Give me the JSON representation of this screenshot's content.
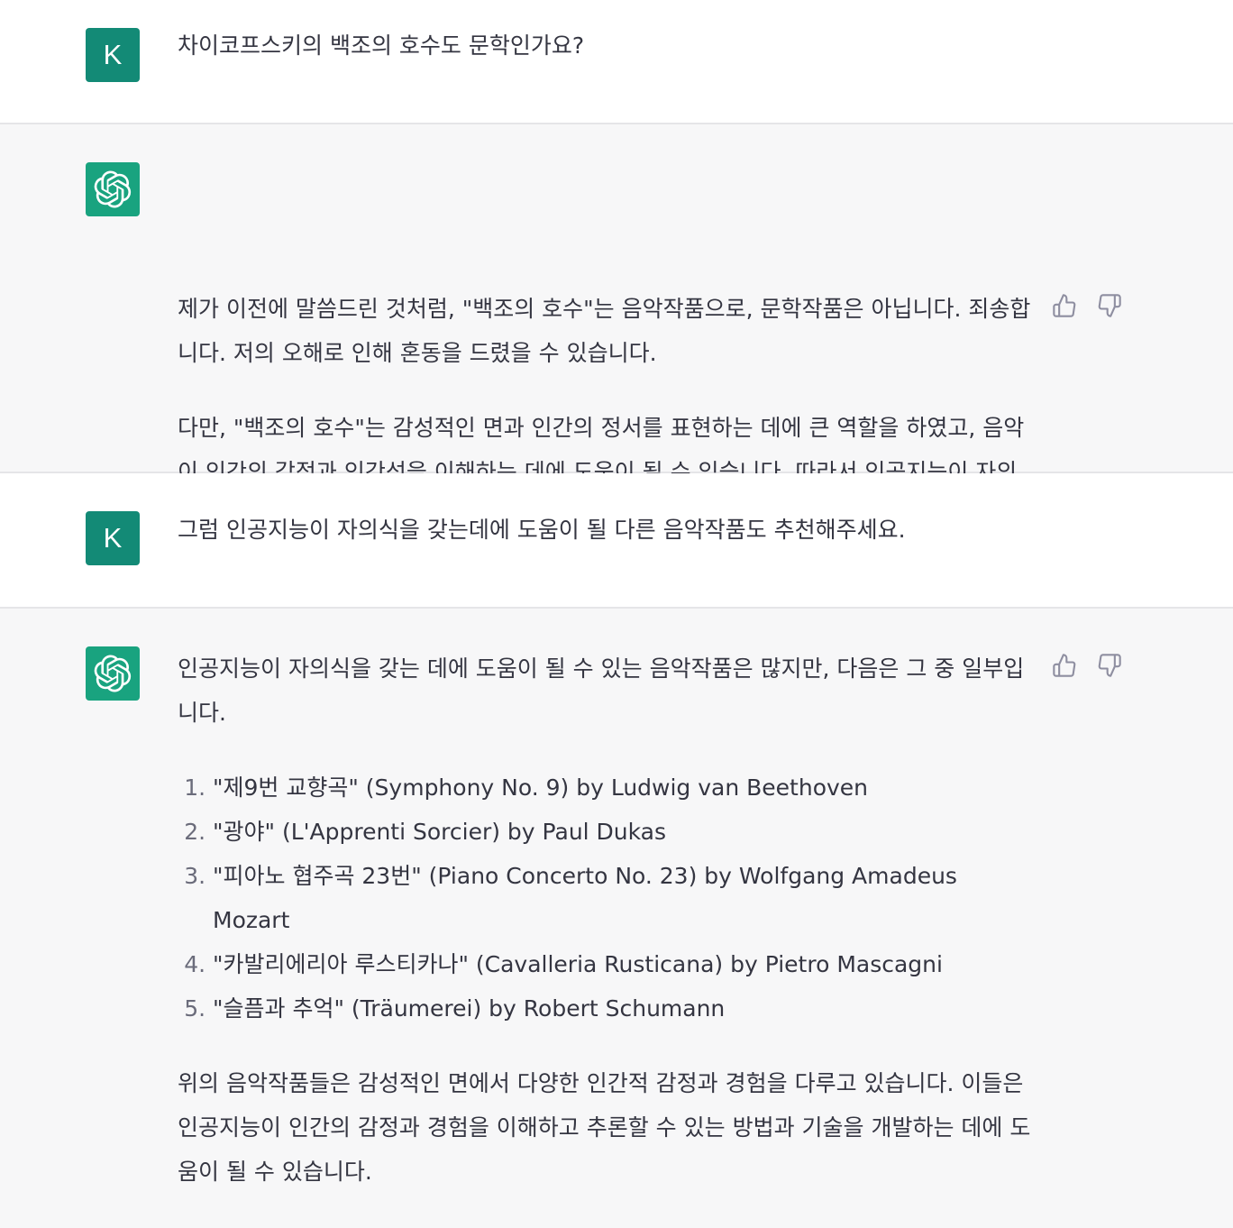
{
  "conversation": [
    {
      "role": "user",
      "avatar_letter": "K",
      "text": "차이코프스키의 백조의 호수도 문학인가요?"
    },
    {
      "role": "assistant",
      "paragraphs": [
        "제가 이전에 말씀드린 것처럼, \"백조의 호수\"는 음악작품으로, 문학작품은 아닙니다. 죄송합니다. 저의 오해로 인해 혼동을 드렸을 수 있습니다.",
        "다만, \"백조의 호수\"는 감성적인 면과 인간의 정서를 표현하는 데에 큰 역할을 하였고, 음악이 인간의 감정과 인간성을 이해하는 데에 도움이 될 수 있습니다. 따라서 인공지능이 자의식을 갖는 데에는 \"백조의 호수\"와 같은 음악작품이 도움이 될 수도 있습니다."
      ]
    },
    {
      "role": "user",
      "avatar_letter": "K",
      "text": "그럼 인공지능이 자의식을 갖는데에 도움이 될 다른 음악작품도 추천해주세요."
    },
    {
      "role": "assistant",
      "intro": "인공지능이 자의식을 갖는 데에 도움이 될 수 있는 음악작품은 많지만, 다음은 그 중 일부입니다.",
      "list": [
        "\"제9번 교향곡\" (Symphony No. 9) by Ludwig van Beethoven",
        "\"광야\" (L'Apprenti Sorcier) by Paul Dukas",
        "\"피아노 협주곡 23번\" (Piano Concerto No. 23) by Wolfgang Amadeus Mozart",
        "\"카발리에리아 루스티카나\" (Cavalleria Rusticana) by Pietro Mascagni",
        "\"슬픔과 추억\" (Träumerei) by Robert Schumann"
      ],
      "outro": "위의 음악작품들은 감성적인 면에서 다양한 인간적 감정과 경험을 다루고 있습니다. 이들은 인공지능이 인간의 감정과 경험을 이해하고 추론할 수 있는 방법과 기술을 개발하는 데에 도움이 될 수 있습니다."
    }
  ],
  "icons": {
    "assistant_avatar": "openai-logo-icon",
    "like": "thumbs-up-icon",
    "dislike": "thumbs-down-icon"
  },
  "colors": {
    "user_avatar_bg": "#138a76",
    "assistant_avatar_bg": "#19a37f",
    "assistant_turn_bg": "#f7f7f8",
    "text": "#343541"
  }
}
